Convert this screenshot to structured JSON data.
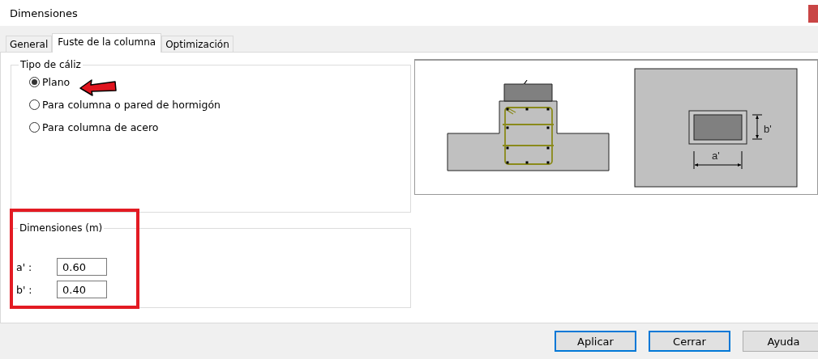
{
  "window": {
    "title": "Dimensiones"
  },
  "tabs": [
    {
      "label": "General",
      "selected": false
    },
    {
      "label": "Fuste de la columna",
      "selected": true
    },
    {
      "label": "Optimización",
      "selected": false
    }
  ],
  "caliz_group": {
    "title": "Tipo de cáliz",
    "options": [
      {
        "label": "Plano",
        "selected": true
      },
      {
        "label": "Para columna o pared de hormigón",
        "selected": false
      },
      {
        "label": "Para columna de acero",
        "selected": false
      }
    ]
  },
  "dimensions_group": {
    "title": "Dimensiones (m)",
    "fields": [
      {
        "label": "a' :",
        "value": "0.60"
      },
      {
        "label": "b' :",
        "value": "0.40"
      }
    ]
  },
  "diagram": {
    "labels": [
      "b'",
      "a'"
    ]
  },
  "annotations": {
    "arrow": true,
    "highlight": true
  },
  "buttons": [
    {
      "label": "Aplicar",
      "focused": true
    },
    {
      "label": "Cerrar",
      "focused": true
    },
    {
      "label": "Ayuda",
      "focused": false
    }
  ]
}
